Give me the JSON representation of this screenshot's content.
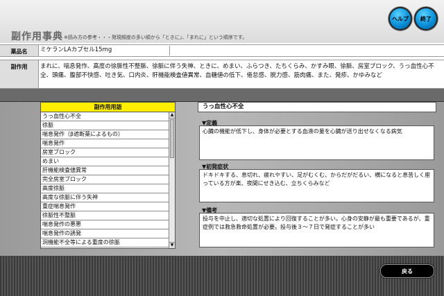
{
  "header": {
    "title": "副作用事典",
    "note": "※読み方の参考・・・発現頻度の多い順から「ときに」、「まれに」という順序です。",
    "help_label": "ヘルプ",
    "exit_label": "終了"
  },
  "drug": {
    "label": "薬品名",
    "value": "ミケランLAカプセル15mg"
  },
  "side_effects": {
    "label": "副作用",
    "value": "まれに、喘息発作、高度の徐脈性不整脈、徐脈に伴う失神、ときに、めまい、ふらつき、たちくらみ、かすみ眼、徐脈、房室ブロック、うっ血性心不全、頭痛、腹部不快感、吐き気、口内炎、肝機能検査値異常、血糖値の低下、倦怠感、脱力感、筋肉痛、また、発疹、かゆみなど"
  },
  "term_list": {
    "header": "副作用用語",
    "items": [
      "うっ血性心不全",
      "徐脈",
      "喘息発作（β遮断薬によるもの）",
      "喘息発作",
      "房室ブロック",
      "めまい",
      "肝機能検査値異常",
      "完全房室ブロック",
      "高度徐脈",
      "高度な徐脈に伴う失神",
      "重症喘息発作",
      "徐脈性不整脈",
      "喘息発作の悪悪",
      "喘息発作の誘発",
      "洞機能不全等による重度の徐脈"
    ]
  },
  "detail": {
    "selected_term": "うっ血性心不全",
    "definition_title": "定義",
    "definition_text": "心臓の機能が低下し、身体が必要とする血液の量を心臓が送り出せなくなる病気",
    "symptoms_title": "初発症状",
    "symptoms_text": "ドキドキする、息切れ、疲れやすい、足がむくむ、からだがだるい、横になると息苦しく座っている方が楽、夜間にせき込む、立ちくらみなど",
    "notes_title": "備考",
    "notes_text": "投与を中止し、適切な処置により回復することが多い。心身の安静が最も重要であるが、重症例では救急救命処置が必要。投与後３〜７日で発症することが多い"
  },
  "footer": {
    "back_label": "戻る"
  },
  "colors": {
    "list_header_bg": "#ffee00",
    "button_blue": "#0a8fd8"
  }
}
